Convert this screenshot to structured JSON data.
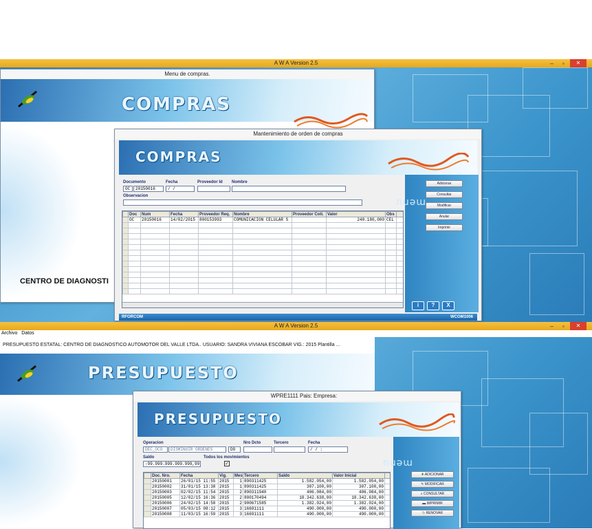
{
  "top_window": {
    "title": "A W A Version 2.5",
    "controls": {
      "minimize": "–",
      "restore": "▫",
      "close": "✕"
    },
    "menu_compras": {
      "title": "Menu de compras.",
      "logo_text": "COMPRAS",
      "center_label": "CENTRO DE DIAGNOSTI"
    },
    "dialog": {
      "title": "Mantenimiento de orden de compras",
      "banner_text": "COMPRAS",
      "labels": {
        "documento": "Documento",
        "fecha": "Fecha",
        "proveedor_id": "Proveedor Id",
        "nombre": "Nombre",
        "observacion": "Observacion"
      },
      "values": {
        "doc_type": "OC",
        "doc_num": "20150016",
        "fecha": "  /  /",
        "proveedor_id": "",
        "nombre": "",
        "observacion": ""
      },
      "grid": {
        "headers": [
          "Doc",
          "Num",
          "Fecha",
          "Proveedor Req.",
          "Nombre",
          "Proveedor Coti.",
          "Valor",
          "Obs"
        ],
        "rows": [
          [
            "OC",
            "20150016",
            "14/02/2015",
            "800153993",
            "COMUNICACION CELULAR S",
            "",
            "240.180,000",
            "CEL"
          ]
        ]
      },
      "side_text": "menu",
      "buttons": [
        "Adicionar",
        "Consultar",
        "Modificar",
        "Anular",
        "Imprimir"
      ],
      "footer_left": "RFORCOM",
      "footer_right": "WCOM1006"
    }
  },
  "bottom_window": {
    "title": "A W A Version 2.5",
    "menubar": [
      "Archivo",
      "Datos"
    ],
    "status_line": "PRESUPUESTO ESTATAL: CENTRO DE DIAGNOSTICO AUTOMOTOR DEL VALLE LTDA.. USUARIO: SANDRA VIVIANA ESCOBAR VIG.:   2015  Plantilla  ...",
    "logo_text": "PRESUPUESTO",
    "dialog": {
      "title": "WPRE1111 Pais:  Empresa:",
      "banner_text": "PRESUPUESTO",
      "labels": {
        "operacion": "Operacion",
        "nro_dcto": "Nro Dcto",
        "tercero": "Tercero",
        "fecha": "Fecha",
        "saldo": "Saldo",
        "todos": "Todos los movimientos"
      },
      "values": {
        "op_code": "DEC_OCO",
        "op_desc": "DISMINUIR ORDENES",
        "op_type": "DO",
        "nro_dcto": "",
        "tercero": "",
        "fecha": "  /  /        :",
        "saldo": "-99.999.999.999.999,99",
        "todos_checked": "✓"
      },
      "grid": {
        "headers": [
          "Doc. Nro.",
          "Fecha",
          "Vig.",
          "Mes",
          "Tercero",
          "Saldo",
          "Valor Inicial"
        ],
        "rows": [
          [
            "20150001",
            "26/01/15 11:55",
            "2015",
            "1",
            "890311425",
            "1.582.054,00",
            "1.582.054,00"
          ],
          [
            "20150002",
            "31/01/15 13:38",
            "2015",
            "1",
            "890311425",
            "307.100,00",
            "307.100,00"
          ],
          [
            "20150003",
            "02/02/15 11:54",
            "2015",
            "2",
            "890311940",
            "406.084,00",
            "406.084,00"
          ],
          [
            "20150005",
            "12/02/15 16:36",
            "2015",
            "2",
            "800170494",
            "18.342.638,00",
            "18.342.638,00"
          ],
          [
            "20150006",
            "24/02/15 14:58",
            "2015",
            "2",
            "900671585",
            "1.382.024,00",
            "1.382.024,00"
          ],
          [
            "20150007",
            "05/03/15 08:12",
            "2015",
            "3",
            "16691111",
            "490.000,00",
            "490.000,00"
          ],
          [
            "20150008",
            "11/03/15 16:59",
            "2015",
            "3",
            "16691111",
            "490.000,00",
            "490.000,00"
          ]
        ]
      },
      "side_text": "menu",
      "buttons": [
        "ADICIONAR",
        "MODIFICAR",
        "CONSULTAR",
        "IMPRIMIR",
        "RENOVAR"
      ]
    }
  }
}
